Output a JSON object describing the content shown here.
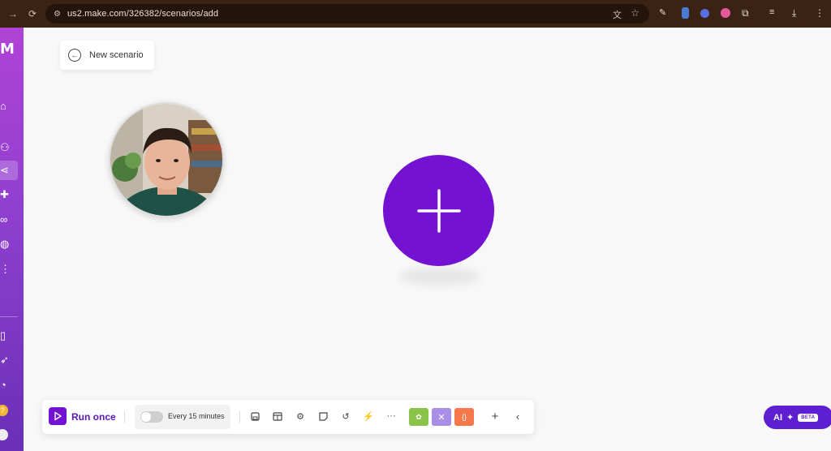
{
  "browser": {
    "url": "us2.make.com/326382/scenarios/add"
  },
  "sidebar": {
    "logo": "M",
    "items": [
      {
        "name": "home",
        "icon": "home-icon"
      },
      {
        "name": "team",
        "icon": "users-icon"
      },
      {
        "name": "scenarios",
        "icon": "share-icon",
        "active": true
      },
      {
        "name": "apps",
        "icon": "puzzle-icon"
      },
      {
        "name": "connections",
        "icon": "link-icon"
      },
      {
        "name": "webhooks",
        "icon": "globe-icon"
      },
      {
        "name": "more",
        "icon": "more-vertical-icon"
      },
      {
        "name": "docs",
        "icon": "book-icon"
      },
      {
        "name": "whats-new",
        "icon": "rocket-icon"
      },
      {
        "name": "notifications",
        "icon": "bell-icon"
      },
      {
        "name": "help",
        "icon": "help-icon"
      },
      {
        "name": "profile",
        "icon": "avatar-icon"
      }
    ]
  },
  "scenario": {
    "name": "New scenario"
  },
  "toolbar": {
    "run_label": "Run once",
    "schedule_label": "Every 15 minutes",
    "schedule_enabled": false,
    "colors": {
      "run": "#7313d1",
      "green": "#8bc34a",
      "lavender": "#a98ee8",
      "orange": "#f5784a"
    }
  },
  "ai": {
    "label": "AI",
    "badge": "BETA"
  },
  "colors": {
    "primary": "#7313d1",
    "sidebar_top": "#b043d6",
    "sidebar_bottom": "#6a2fb6"
  }
}
